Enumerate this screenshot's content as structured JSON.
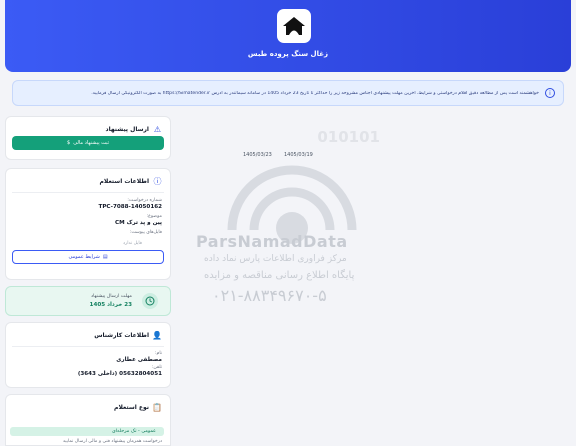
{
  "header": {
    "title": "زغال سنگ پروده طبس"
  },
  "notice": {
    "text": "خواهشمند است پس از مطالعه دقیق اقلام درخواستی و شرایط، آخرین مهلت پیشنهادی اجناس مشروحه زیر را حداکثر تا تاریخ 23 خرداد 1405 در سامانه سیماتندر به آدرس https://Simatender.ir به صورت الکترونیکی ارسال فرمایید."
  },
  "submit_card": {
    "title": "ارسال پیشنهاد",
    "button": "ثبت پیشنهاد مالی"
  },
  "inquiry_card": {
    "title": "اطلاعات استعلام",
    "request_no_label": "شماره درخواست:",
    "request_no": "TPC-7088-14050162",
    "subject_label": "موضوع:",
    "subject": "پین و پد ترک CM",
    "attachments_label": "فایل‌های پیوست:",
    "no_file": "فایل ندارد",
    "conditions_button": "شرایط عمومی"
  },
  "deadline": {
    "label": "مهلت ارسال پیشنهاد",
    "value": "23 خرداد 1405"
  },
  "expert_card": {
    "title": "اطلاعات کارشناس",
    "name_label": "نام:",
    "name": "مصطفی عطاری",
    "phone_label": "تلفن:",
    "phone": "05632804051 (داخلی 3643)"
  },
  "type_card": {
    "title": "نوع استعلام",
    "badge": "عمومی - تک مرحله‌ای",
    "note": "درخواست همزمان پیشنهاد فنی و مالی ارسال نمایید"
  },
  "dates": {
    "d1": "1405/03/19",
    "d2": "1405/03/23"
  },
  "watermark": {
    "brand": "ParsNamadData",
    "line1": "مرکز فراوری اطلاعات پارس نماد داده",
    "line2": "پایگاه اطلاع رسانی مناقصه و مزایده",
    "phone": "۰۲۱-۸۸۳۴۹۶۷۰-۵",
    "digits": "010101"
  },
  "colors": {
    "primary": "#2f4de0",
    "green": "#14a07a",
    "bg": "#f3f4f8"
  }
}
